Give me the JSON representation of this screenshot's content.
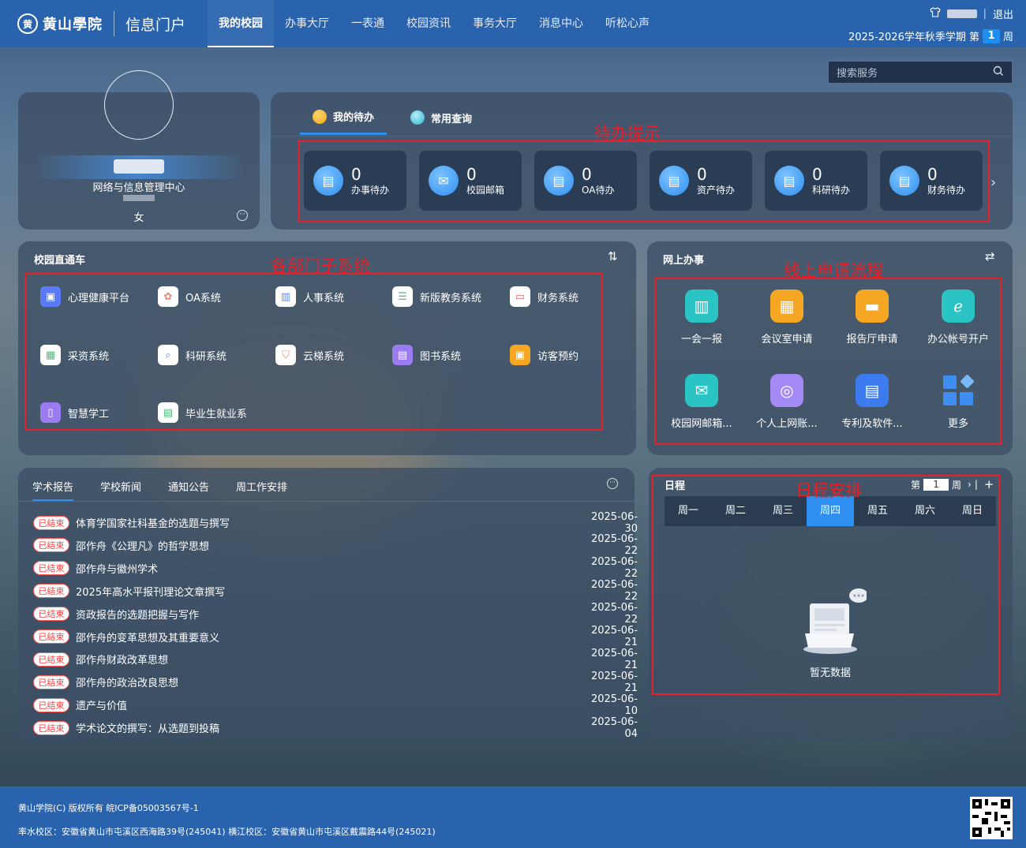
{
  "header": {
    "logo_text": "黄山學院",
    "portal_name": "信息门户",
    "nav": [
      "我的校园",
      "办事大厅",
      "一表通",
      "校园资讯",
      "事务大厅",
      "消息中心",
      "听松心声"
    ],
    "logout": "退出",
    "term_text": "2025-2026学年秋季学期 第",
    "week_number": "1",
    "week_suffix": "周"
  },
  "search": {
    "placeholder": "搜索服务"
  },
  "profile": {
    "department": "网络与信息管理中心",
    "gender": "女"
  },
  "todo": {
    "tabs": [
      "我的待办",
      "常用查询"
    ],
    "annotation": "待办提示",
    "cards": [
      {
        "count": "0",
        "label": "办事待办"
      },
      {
        "count": "0",
        "label": "校园邮箱"
      },
      {
        "count": "0",
        "label": "OA待办"
      },
      {
        "count": "0",
        "label": "资产待办"
      },
      {
        "count": "0",
        "label": "科研待办"
      },
      {
        "count": "0",
        "label": "财务待办"
      }
    ]
  },
  "campus_express": {
    "title": "校园直通车",
    "annotation": "各部门子系统",
    "items": [
      "心理健康平台",
      "OA系统",
      "人事系统",
      "新版教务系统",
      "财务系统",
      "采资系统",
      "科研系统",
      "云梯系统",
      "图书系统",
      "访客预约",
      "智慧学工",
      "毕业生就业系"
    ]
  },
  "online_services": {
    "title": "网上办事",
    "annotation": "线上申请流程",
    "items": [
      "一会一报",
      "会议室申请",
      "报告厅申请",
      "办公帐号开户",
      "校园网邮箱...",
      "个人上网账...",
      "专利及软件...",
      "更多"
    ]
  },
  "news": {
    "tabs": [
      "学术报告",
      "学校新闻",
      "通知公告",
      "周工作安排"
    ],
    "badge": "已结束",
    "rows": [
      {
        "title": "体育学国家社科基金的选题与撰写",
        "date": "2025-06-30"
      },
      {
        "title": "邵作舟《公理凡》的哲学思想",
        "date": "2025-06-22"
      },
      {
        "title": "邵作舟与徽州学术",
        "date": "2025-06-22"
      },
      {
        "title": "2025年高水平报刊理论文章撰写",
        "date": "2025-06-22"
      },
      {
        "title": "资政报告的选题把握与写作",
        "date": "2025-06-22"
      },
      {
        "title": "邵作舟的变革思想及其重要意义",
        "date": "2025-06-21"
      },
      {
        "title": "邵作舟财政改革思想",
        "date": "2025-06-21"
      },
      {
        "title": "邵作舟的政治改良思想",
        "date": "2025-06-21"
      },
      {
        "title": "遗产与价值",
        "date": "2025-06-10"
      },
      {
        "title": "学术论文的撰写：从选题到投稿",
        "date": "2025-06-04"
      }
    ]
  },
  "schedule": {
    "title": "日程",
    "annotation": "日程安排",
    "week_prefix": "第",
    "week_value": "1",
    "week_suffix": "周",
    "days": [
      "周一",
      "周二",
      "周三",
      "周四",
      "周五",
      "周六",
      "周日"
    ],
    "active_day": "周四",
    "empty_text": "暂无数据"
  },
  "footer": {
    "copyright": "黄山学院(C) 版权所有 皖ICP备05003567号-1",
    "address": "率水校区：安徽省黄山市屯溪区西海路39号(245041) 横江校区：安徽省黄山市屯溪区戴震路44号(245021)"
  }
}
